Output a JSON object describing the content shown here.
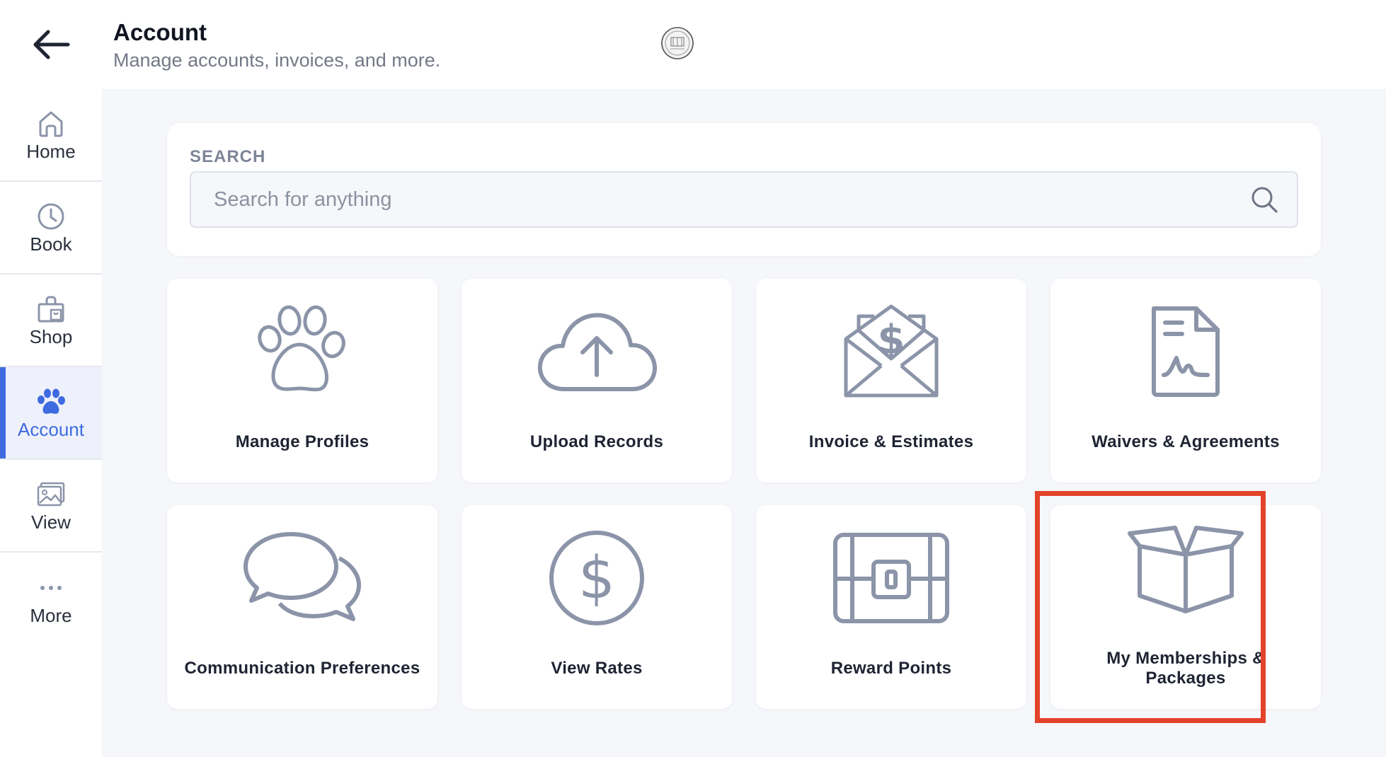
{
  "header": {
    "title": "Account",
    "subtitle": "Manage accounts, invoices, and more.",
    "back_icon": "arrow-left-icon",
    "logo": "brand-seal-logo"
  },
  "sidebar": {
    "items": [
      {
        "label": "Home",
        "icon": "home-icon",
        "active": false
      },
      {
        "label": "Book",
        "icon": "clock-icon",
        "active": false
      },
      {
        "label": "Shop",
        "icon": "shopping-bag-icon",
        "active": false
      },
      {
        "label": "Account",
        "icon": "paw-icon",
        "active": true
      },
      {
        "label": "View",
        "icon": "image-icon",
        "active": false
      },
      {
        "label": "More",
        "icon": "ellipsis-icon",
        "active": false
      }
    ]
  },
  "search": {
    "label": "SEARCH",
    "placeholder": "Search for anything",
    "value": ""
  },
  "tiles": [
    {
      "label": "Manage Profiles",
      "icon": "paw-icon"
    },
    {
      "label": "Upload Records",
      "icon": "cloud-upload-icon"
    },
    {
      "label": "Invoice & Estimates",
      "icon": "envelope-dollar-icon"
    },
    {
      "label": "Waivers & Agreements",
      "icon": "signed-document-icon"
    },
    {
      "label": "Communication Preferences",
      "icon": "chat-bubbles-icon"
    },
    {
      "label": "View Rates",
      "icon": "dollar-circle-icon"
    },
    {
      "label": "Reward Points",
      "icon": "treasure-chest-icon"
    },
    {
      "label": "My Memberships & Packages",
      "icon": "open-box-icon",
      "highlighted": true
    }
  ],
  "colors": {
    "accent": "#3e6be0",
    "icon_gray": "#8b94a8",
    "highlight": "#e3432a",
    "background": "#f6f7fa"
  }
}
